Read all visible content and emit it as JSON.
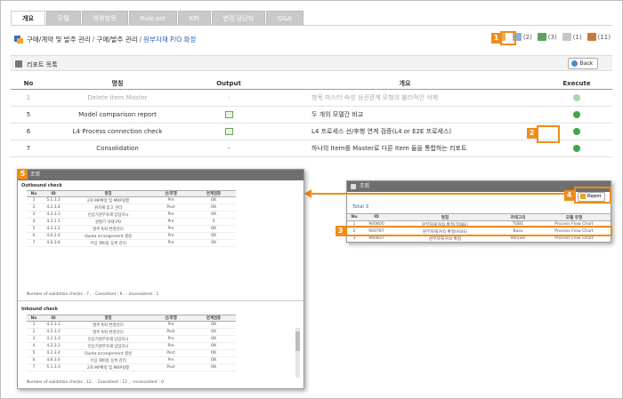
{
  "tabs": [
    {
      "label": "개요",
      "active": true
    },
    {
      "label": "모델",
      "active": false
    },
    {
      "label": "하위항목",
      "active": false
    },
    {
      "label": "Rule set",
      "active": false
    },
    {
      "label": "KPI",
      "active": false
    },
    {
      "label": "변경 담당자",
      "active": false
    },
    {
      "label": "Q&A",
      "active": false
    }
  ],
  "breadcrumb": {
    "items": [
      "구매/계약 및 발주 관리",
      "구매/발주 관리"
    ],
    "current": "원부자재 P/O 확정",
    "separator": "/"
  },
  "toolbar": {
    "items": [
      {
        "icon": "report-folder-icon",
        "label": ""
      },
      {
        "icon": "document-icon",
        "label": "(2)"
      },
      {
        "icon": "flow-icon",
        "label": "(3)"
      },
      {
        "icon": "copy-icon",
        "label": "(1)"
      },
      {
        "icon": "people-icon",
        "label": "(11)"
      }
    ]
  },
  "section": {
    "title": "리포트 목록",
    "back_label": "Back"
  },
  "main_table": {
    "headers": {
      "no": "No",
      "name": "명칭",
      "output": "Output",
      "overview": "개요",
      "execute": "Execute"
    },
    "rows": [
      {
        "no": "1",
        "name": "Delete Item Master",
        "output": "-",
        "overview": "항목 마스터 속성 상관관계 모형의 불리적인 삭제",
        "faded": true
      },
      {
        "no": "5",
        "name": "Model comparison report",
        "output": "icon",
        "overview": "두 개의 모델간 비교",
        "faded": false
      },
      {
        "no": "6",
        "name": "L4 Process connection check",
        "output": "icon",
        "overview": "L4 프로세스 선/후행 연계 검증(L4 or E2E 프로세스)",
        "faded": false
      },
      {
        "no": "7",
        "name": "Consolidation",
        "output": "-",
        "overview": "하나의 Item를 Master로 다른 Item 들을 통합하는 리포트",
        "faded": false
      }
    ]
  },
  "callouts": [
    "1",
    "2",
    "3",
    "4",
    "5"
  ],
  "popup_left": {
    "title": "조회",
    "outbound": {
      "title": "Outbound check",
      "headers": [
        "No",
        "ID",
        "명칭",
        "선/후행",
        "연계검증"
      ],
      "rows": [
        [
          "1",
          "5.1.3.3",
          "2차 MP확정 및 MRP실행",
          "Pre",
          "OK"
        ],
        [
          "2",
          "4.2.3.4",
          "원자재 입고 관리",
          "Post",
          "OK"
        ],
        [
          "3",
          "4.2.3.3",
          "진납기원부자재 납입지시",
          "Pre",
          "OK"
        ],
        [
          "4",
          "4.2.1.1",
          "원발기 자재 PO",
          "Pre",
          "X"
        ],
        [
          "5",
          "4.2.3.2",
          "발주 P/O 변경관리",
          "Pre",
          "OK"
        ],
        [
          "6",
          "4.6.2.4",
          "Quota arrangement 생성",
          "Pre",
          "OK"
        ],
        [
          "7",
          "4.6.3.6",
          "수입 제비용 등록 관리",
          "Pre",
          "OK"
        ]
      ],
      "summary": "Number of validation checks : 7 ,  - Consistent : 6 ,  - Inconsistent : 1"
    },
    "inbound": {
      "title": "Inbound check",
      "headers": [
        "No",
        "ID",
        "명칭",
        "선/후행",
        "연계검증"
      ],
      "rows": [
        [
          "1",
          "4.2.3.3",
          "발주 P/O 변경관리",
          "Pre",
          "OK"
        ],
        [
          "2",
          "4.2.3.3",
          "발주 P/O 변경관리",
          "Post",
          "OK"
        ],
        [
          "3",
          "4.2.3.3",
          "진납기원부자재 납입지시",
          "Pre",
          "OK"
        ],
        [
          "4",
          "4.2.3.3",
          "진납기원부자재 납입지시",
          "Pre",
          "OK"
        ],
        [
          "5",
          "4.2.3.4",
          "Quota arrangement 생성",
          "Post",
          "OK"
        ],
        [
          "6",
          "4.6.3.6",
          "수입 제비용 등록 관리",
          "Pre",
          "OK"
        ],
        [
          "7",
          "5.1.3.3",
          "2차 MP확정 및 MRP실행",
          "Post",
          "OK"
        ]
      ],
      "summary": "Number of validation checks : 12 ,  - Consistent : 12 ,  - Inconsistent : 0"
    }
  },
  "popup_right": {
    "title": "조회",
    "report_label": "Report",
    "total": "Total 3",
    "headers": [
      "No",
      "ID",
      "명칭",
      "카테고리",
      "모델 유형"
    ],
    "rows": [
      [
        "1",
        "900800",
        "원부자재 P/O 확정(TOBE)",
        "TOBE",
        "Process Flow Chart"
      ],
      [
        "2",
        "900787",
        "원부자재 P/O 확정(ASIS)",
        "Base",
        "Process Flow Chart"
      ],
      [
        "3",
        "900837",
        "원부자재 P/O 확정",
        "Version",
        "Process Flow Chart"
      ]
    ]
  },
  "colors": {
    "accent_orange": "#f08c1a",
    "link_blue": "#2b5fb8",
    "run_green": "#3da74a"
  }
}
